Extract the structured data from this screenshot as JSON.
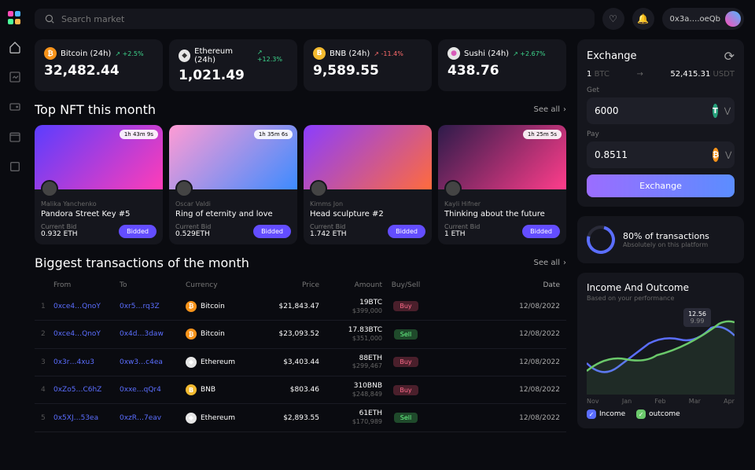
{
  "search": {
    "placeholder": "Search market"
  },
  "wallet": {
    "address": "0x3a….oeQb"
  },
  "tickers": [
    {
      "name": "Bitcoin (24h)",
      "change": "+2.5%",
      "change_color": "#3dd68c",
      "value": "32,482.44",
      "icon_bg": "#f7931a",
      "icon_fg": "#fff",
      "icon": "₿"
    },
    {
      "name": "Ethereum (24h)",
      "change": "+12.3%",
      "change_color": "#3dd68c",
      "value": "1,021.49",
      "icon_bg": "#e6e6e6",
      "icon_fg": "#333",
      "icon": "◆"
    },
    {
      "name": "BNB (24h)",
      "change": "-11.4%",
      "change_color": "#ff6b6b",
      "value": "9,589.55",
      "icon_bg": "#f3ba2f",
      "icon_fg": "#fff",
      "icon": "B"
    },
    {
      "name": "Sushi (24h)",
      "change": "+2.67%",
      "change_color": "#3dd68c",
      "value": "438.76",
      "icon_bg": "#e6e6e6",
      "icon_fg": "#d85bb8",
      "icon": "●"
    }
  ],
  "nft_section": {
    "title": "Top NFT this month",
    "see_all": "See all"
  },
  "nfts": [
    {
      "time": "1h 43m 9s",
      "author": "Malika Yanchenko",
      "title": "Pandora Street Key #5",
      "bid_label": "Current Bid",
      "bid": "0.932 ETH",
      "btn": "Bidded",
      "img": "linear-gradient(135deg,#5b3dff,#ff3db8)"
    },
    {
      "time": "1h 35m 6s",
      "author": "Oscar Valdi",
      "title": "Ring of eternity and love",
      "bid_label": "Current Bid",
      "bid": "0.529ETH",
      "btn": "Bidded",
      "img": "linear-gradient(135deg,#ff9bd4,#3d8bff)"
    },
    {
      "time": "",
      "author": "Kimms Jon",
      "title": "Head sculpture #2",
      "bid_label": "Current Bid",
      "bid": "1.742 ETH",
      "btn": "Bidded",
      "img": "linear-gradient(135deg,#8b3dff,#ff6b3d)"
    },
    {
      "time": "1h 25m 5s",
      "author": "Kayli Hifner",
      "title": "Thinking about the future",
      "bid_label": "Current Bid",
      "bid": "1 ETH",
      "btn": "Bidded",
      "img": "linear-gradient(135deg,#2d1b4a,#ff3d8b)"
    }
  ],
  "tx_section": {
    "title": "Biggest transactions of the month",
    "see_all": "See all"
  },
  "tx_headers": {
    "from": "From",
    "to": "To",
    "currency": "Currency",
    "price": "Price",
    "amount": "Amount",
    "bs": "Buy/Sell",
    "date": "Date"
  },
  "transactions": [
    {
      "idx": "1",
      "from": "0xce4…QnoY",
      "to": "0xr5…rq3Z",
      "curr": "Bitcoin",
      "icon_bg": "#f7931a",
      "icon": "₿",
      "price": "$21,843.47",
      "amt1": "19BTC",
      "amt2": "$399,000",
      "bs": "Buy",
      "bs_class": "buy",
      "date": "12/08/2022"
    },
    {
      "idx": "2",
      "from": "0xce4…QnoY",
      "to": "0x4d…3daw",
      "curr": "Bitcoin",
      "icon_bg": "#f7931a",
      "icon": "₿",
      "price": "$23,093.52",
      "amt1": "17.83BTC",
      "amt2": "$351,000",
      "bs": "Sell",
      "bs_class": "sell",
      "date": "12/08/2022"
    },
    {
      "idx": "3",
      "from": "0x3r…4xu3",
      "to": "0xw3…c4ea",
      "curr": "Ethereum",
      "icon_bg": "#e6e6e6",
      "icon": "◆",
      "price": "$3,403.44",
      "amt1": "88ETH",
      "amt2": "$299,467",
      "bs": "Buy",
      "bs_class": "buy",
      "date": "12/08/2022"
    },
    {
      "idx": "4",
      "from": "0xZo5…C6hZ",
      "to": "0xxe…qQr4",
      "curr": "BNB",
      "icon_bg": "#f3ba2f",
      "icon": "B",
      "price": "$803.46",
      "amt1": "310BNB",
      "amt2": "$248,849",
      "bs": "Buy",
      "bs_class": "buy",
      "date": "12/08/2022"
    },
    {
      "idx": "5",
      "from": "0x5XJ…53ea",
      "to": "0xzR…7eav",
      "curr": "Ethereum",
      "icon_bg": "#e6e6e6",
      "icon": "◆",
      "price": "$2,893.55",
      "amt1": "61ETH",
      "amt2": "$170,989",
      "bs": "Sell",
      "bs_class": "sell",
      "date": "12/08/2022"
    }
  ],
  "exchange": {
    "title": "Exchange",
    "from_amt": "1",
    "from_sym": "BTC",
    "to_amt": "52,415.31",
    "to_sym": "USDT",
    "get_label": "Get",
    "get_value": "6000",
    "get_coin_bg": "#26a17b",
    "get_coin": "T",
    "pay_label": "Pay",
    "pay_value": "0.8511",
    "pay_coin_bg": "#f7931a",
    "pay_coin": "₿",
    "btn": "Exchange"
  },
  "stat": {
    "title": "80% of transactions",
    "sub": "Absolutely on this platform"
  },
  "income": {
    "title": "Income And Outcome",
    "sub": "Based on your performance",
    "tip1": "12.56",
    "tip2": "9.99",
    "axis": [
      "Nov",
      "Jan",
      "Feb",
      "Mar",
      "Apr"
    ],
    "legend1": "Income",
    "legend2": "outcome"
  },
  "chart_data": {
    "type": "line",
    "x": [
      "Nov",
      "Jan",
      "Feb",
      "Mar",
      "Apr"
    ],
    "series": [
      {
        "name": "Income",
        "values": [
          6,
          5,
          9,
          12.5,
          11
        ],
        "color": "#5b6eff"
      },
      {
        "name": "outcome",
        "values": [
          5,
          7,
          7.5,
          10,
          13
        ],
        "color": "#6bc96b"
      }
    ],
    "ylim": [
      0,
      14
    ],
    "tooltip": {
      "x": "Mar",
      "income": 12.56,
      "outcome": 9.99
    }
  }
}
